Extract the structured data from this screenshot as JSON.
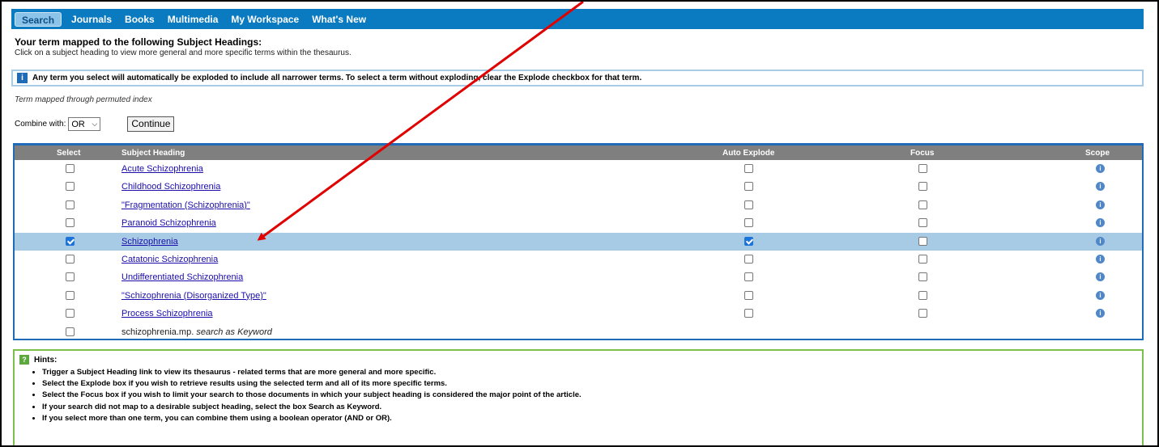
{
  "nav": {
    "items": [
      "Search",
      "Journals",
      "Books",
      "Multimedia",
      "My Workspace",
      "What's New"
    ],
    "active": "Search"
  },
  "page": {
    "title": "Your term mapped to the following Subject Headings:",
    "subtitle": "Click on a subject heading to view more general and more specific terms within the thesaurus."
  },
  "info": {
    "text": "Any term you select will automatically be exploded to include all narrower terms. To select a term without exploding, clear the Explode checkbox for that term."
  },
  "permuted_note": "Term mapped through permuted index",
  "combine": {
    "label": "Combine with:",
    "selected": "OR",
    "continue_label": "Continue"
  },
  "table": {
    "headers": {
      "select": "Select",
      "heading": "Subject Heading",
      "auto_explode": "Auto Explode",
      "focus": "Focus",
      "scope": "Scope"
    },
    "rows": [
      {
        "heading": "Acute Schizophrenia",
        "select": false,
        "explode": false,
        "focus": false
      },
      {
        "heading": "Childhood Schizophrenia",
        "select": false,
        "explode": false,
        "focus": false
      },
      {
        "heading": "\"Fragmentation (Schizophrenia)\"",
        "select": false,
        "explode": false,
        "focus": false
      },
      {
        "heading": "Paranoid Schizophrenia",
        "select": false,
        "explode": false,
        "focus": false
      },
      {
        "heading": "Schizophrenia",
        "select": true,
        "explode": true,
        "focus": false
      },
      {
        "heading": "Catatonic Schizophrenia",
        "select": false,
        "explode": false,
        "focus": false
      },
      {
        "heading": "Undifferentiated Schizophrenia",
        "select": false,
        "explode": false,
        "focus": false
      },
      {
        "heading": "\"Schizophrenia (Disorganized Type)\"",
        "select": false,
        "explode": false,
        "focus": false
      },
      {
        "heading": "Process Schizophrenia",
        "select": false,
        "explode": false,
        "focus": false
      }
    ],
    "keyword_row": {
      "term": "schizophrenia.mp.",
      "suffix": "search as Keyword"
    }
  },
  "hints": {
    "title": "Hints:",
    "items": [
      "Trigger a Subject Heading link to view its thesaurus - related terms that are more general and more specific.",
      "Select the Explode box if you wish to retrieve results using the selected term and all of its more specific terms.",
      "Select the Focus box if you wish to limit your search to those documents in which your subject heading is considered the major point of the article.",
      "If your search did not map to a desirable subject heading, select the box Search as Keyword.",
      "If you select more than one term, you can combine them using a boolean operator (AND or OR)."
    ]
  },
  "colors": {
    "nav_bg": "#0b7bc1",
    "selected_row": "#a7cbe4",
    "annotation_arrow": "#e00000",
    "hint_border": "#7cc04b"
  }
}
